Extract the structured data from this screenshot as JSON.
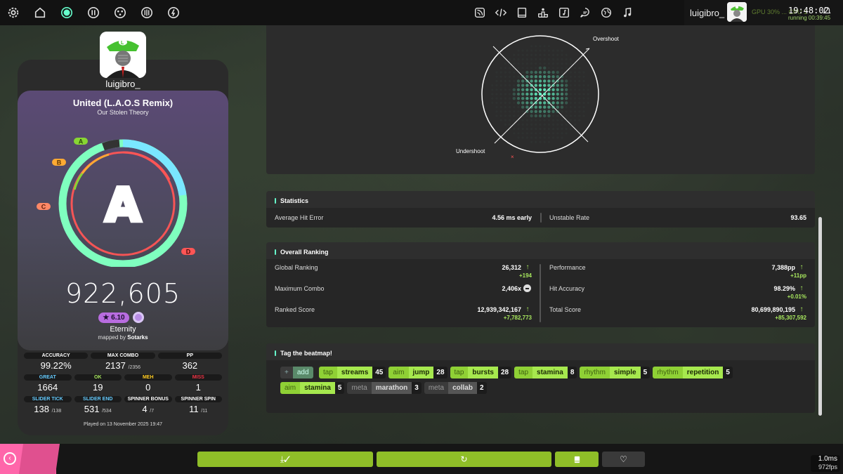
{
  "topbar": {
    "left_icons": [
      "settings-icon",
      "home-icon",
      "ruleset-osu-icon",
      "ruleset-taiko-icon",
      "ruleset-catch-icon",
      "ruleset-mania-icon",
      "ruleset-custom-icon"
    ],
    "right_icons": [
      "news-icon",
      "devtools-icon",
      "wiki-icon",
      "rankings-icon",
      "beatmap-listing-icon",
      "chat-icon",
      "dashboard-icon",
      "music-icon"
    ],
    "username": "luigibro_",
    "time": "19:48:02",
    "running": "running 00:39:45",
    "gpu_text": "GPU 30% ... CPU 1"
  },
  "player": {
    "name": "luigibro_"
  },
  "score": {
    "title": "United (L.A.O.S Remix)",
    "artist": "Our Stolen Theory",
    "grade": "A",
    "grade_labels": {
      "a": "A",
      "b": "B",
      "c": "C",
      "d": "D"
    },
    "total": "922,605",
    "stars": "★ 6.10",
    "difficulty": "Eternity",
    "mapped_by_prefix": "mapped by",
    "mapper": "Sotarks",
    "played_on": "Played on 13 November 2025 19:47",
    "colors": {
      "accent": "#66ffcc",
      "great": "#66ccff",
      "ok": "#a8e85e",
      "meh": "#ffcc22",
      "miss": "#ee3344"
    }
  },
  "stats_row1": [
    {
      "label": "ACCURACY",
      "value": "99.22%",
      "sub": ""
    },
    {
      "label": "MAX COMBO",
      "value": "2137",
      "sub": "/2356"
    },
    {
      "label": "PP",
      "value": "362",
      "sub": ""
    }
  ],
  "stats_row2": [
    {
      "label": "GREAT",
      "value": "1664"
    },
    {
      "label": "OK",
      "value": "19"
    },
    {
      "label": "MEH",
      "value": "0"
    },
    {
      "label": "MISS",
      "value": "1"
    }
  ],
  "stats_row3": [
    {
      "label": "SLIDER TICK",
      "value": "138",
      "sub": "/138"
    },
    {
      "label": "SLIDER END",
      "value": "531",
      "sub": "/534"
    },
    {
      "label": "SPINNER BONUS",
      "value": "4",
      "sub": "/7"
    },
    {
      "label": "SPINNER SPIN",
      "value": "11",
      "sub": "/11"
    }
  ],
  "accuracy_heatmap": {
    "overshoot_label": "Overshoot",
    "undershoot_label": "Undershoot"
  },
  "statistics": {
    "title": "Statistics",
    "avg_hit_error_label": "Average Hit Error",
    "avg_hit_error_value": "4.56 ms early",
    "unstable_rate_label": "Unstable Rate",
    "unstable_rate_value": "93.65"
  },
  "overall_ranking": {
    "title": "Overall Ranking",
    "global_ranking_label": "Global Ranking",
    "global_ranking_value": "26,312",
    "global_ranking_delta": "+194",
    "performance_label": "Performance",
    "performance_value": "7,388pp",
    "performance_delta": "+11pp",
    "max_combo_label": "Maximum Combo",
    "max_combo_value": "2,406x",
    "hit_accuracy_label": "Hit Accuracy",
    "hit_accuracy_value": "98.29%",
    "hit_accuracy_delta": "+0.01%",
    "ranked_score_label": "Ranked Score",
    "ranked_score_value": "12,939,342,167",
    "ranked_score_delta": "+7,782,773",
    "total_score_label": "Total Score",
    "total_score_value": "80,699,890,195",
    "total_score_delta": "+85,307,592"
  },
  "tags": {
    "title": "Tag the beatmap!",
    "add": {
      "prefix": "+",
      "label": "add"
    },
    "items": [
      {
        "cat": "tap",
        "name": "streams",
        "count": "45",
        "style": "green"
      },
      {
        "cat": "aim",
        "name": "jump",
        "count": "28",
        "style": "green"
      },
      {
        "cat": "tap",
        "name": "bursts",
        "count": "28",
        "style": "green"
      },
      {
        "cat": "tap",
        "name": "stamina",
        "count": "8",
        "style": "green"
      },
      {
        "cat": "rhythm",
        "name": "simple",
        "count": "5",
        "style": "green"
      },
      {
        "cat": "rhythm",
        "name": "repetition",
        "count": "5",
        "style": "green"
      },
      {
        "cat": "aim",
        "name": "stamina",
        "count": "5",
        "style": "green"
      },
      {
        "cat": "meta",
        "name": "marathon",
        "count": "3",
        "style": "grey"
      },
      {
        "cat": "meta",
        "name": "collab",
        "count": "2",
        "style": "grey"
      }
    ]
  },
  "bottombar": {
    "back_label": "back",
    "buttons": [
      "download-icon",
      "retry-icon",
      "collection-icon",
      "favourite-icon"
    ],
    "frametime": "1.0ms",
    "fps": "972fps"
  }
}
